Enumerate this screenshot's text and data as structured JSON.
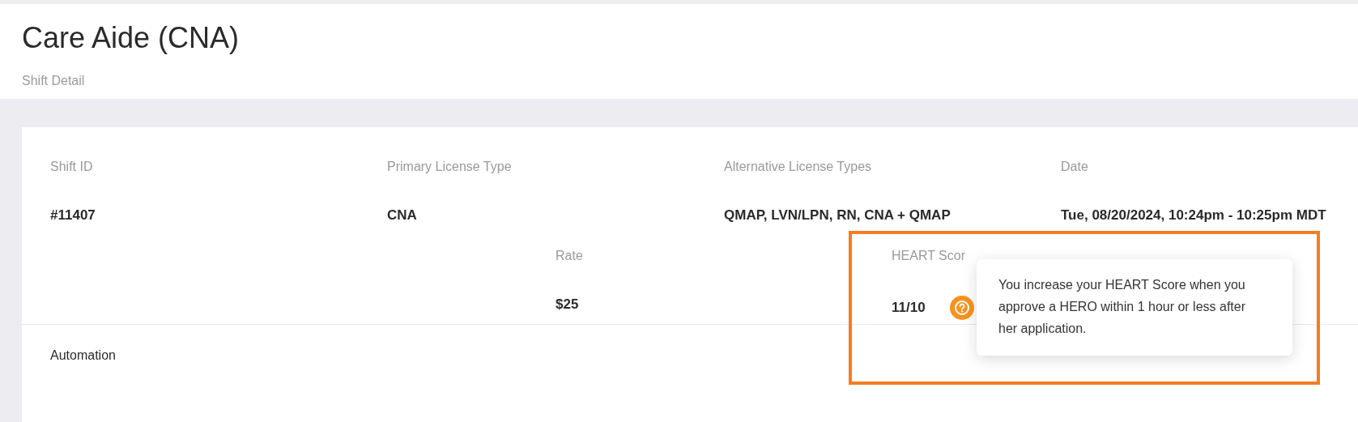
{
  "header": {
    "title": "Care Aide (CNA)",
    "subtitle": "Shift Detail"
  },
  "fields": [
    {
      "label": "Shift ID",
      "value": "#11407"
    },
    {
      "label": "Primary License Type",
      "value": "CNA"
    },
    {
      "label": "Alternative License Types",
      "value": "QMAP, LVN/LPN, RN, CNA + QMAP"
    },
    {
      "label": "Date",
      "value": "Tue, 08/20/2024, 10:24pm - 10:25pm MDT"
    }
  ],
  "rate": {
    "label": "Rate",
    "value": "$25"
  },
  "heart_score": {
    "label": "HEART Scor",
    "value": "11/10"
  },
  "tooltip": {
    "text": "You increase your HEART Score when you approve a HERO within 1 hour or less after her application."
  },
  "section": {
    "title": "Automation"
  }
}
